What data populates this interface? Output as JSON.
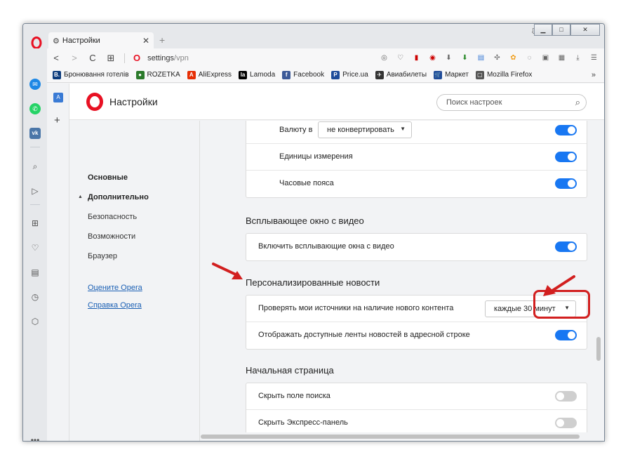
{
  "tab": {
    "title": "Настройки",
    "new_tab": "+"
  },
  "window_controls": {
    "minimize": "▁",
    "maximize": "□",
    "close": "✕",
    "menu": "⇩"
  },
  "addressbar": {
    "back": "<",
    "forward": ">",
    "reload": "C",
    "grid": "⊞",
    "url_host": "settings",
    "url_path": "/vpn"
  },
  "bookmarks": [
    {
      "label": "Бронювання готелів",
      "icon_text": "B.",
      "color": "#0c3b7c"
    },
    {
      "label": "ROZETKA",
      "icon_text": "●",
      "color": "#2b7a2b"
    },
    {
      "label": "AliExpress",
      "icon_text": "A",
      "color": "#e62e04"
    },
    {
      "label": "Lamoda",
      "icon_text": "la",
      "color": "#000000"
    },
    {
      "label": "Facebook",
      "icon_text": "f",
      "color": "#3b5998"
    },
    {
      "label": "Price.ua",
      "icon_text": "P",
      "color": "#1e4c9a"
    },
    {
      "label": "Авиабилеты",
      "icon_text": "✈",
      "color": "#333333"
    },
    {
      "label": "Маркет",
      "icon_text": "🛒",
      "color": "#1e4c9a"
    },
    {
      "label": "Mozilla Firefox",
      "icon_text": "▢",
      "color": "#555555"
    }
  ],
  "bookmarks_more": "»",
  "header": {
    "title": "Настройки",
    "search_placeholder": "Поиск настроек"
  },
  "nav": {
    "basic": "Основные",
    "advanced": "Дополнительно",
    "security": "Безопасность",
    "features": "Возможности",
    "browser": "Браузер",
    "rate": "Оцените Opera",
    "help": "Справка Opera"
  },
  "sections": {
    "top_card": {
      "currency_label": "Валюту в",
      "currency_value": "не конвертировать",
      "units_label": "Единицы измерения",
      "timezones_label": "Часовые пояса"
    },
    "video": {
      "title": "Всплывающее окно с видео",
      "enable_label": "Включить всплывающие окна с видео"
    },
    "news": {
      "title": "Персонализированные новости",
      "check_label": "Проверять мои источники на наличие нового контента",
      "check_value": "каждые 30 минут",
      "show_label": "Отображать доступные ленты новостей в адресной строке"
    },
    "startpage": {
      "title": "Начальная страница",
      "hide_search_label": "Скрыть поле поиска",
      "hide_speed_dial_label": "Скрыть Экспресс-панель"
    }
  },
  "colors": {
    "accent": "#1877f2",
    "annotation": "#d21f1f",
    "opera_red": "#e81123"
  }
}
